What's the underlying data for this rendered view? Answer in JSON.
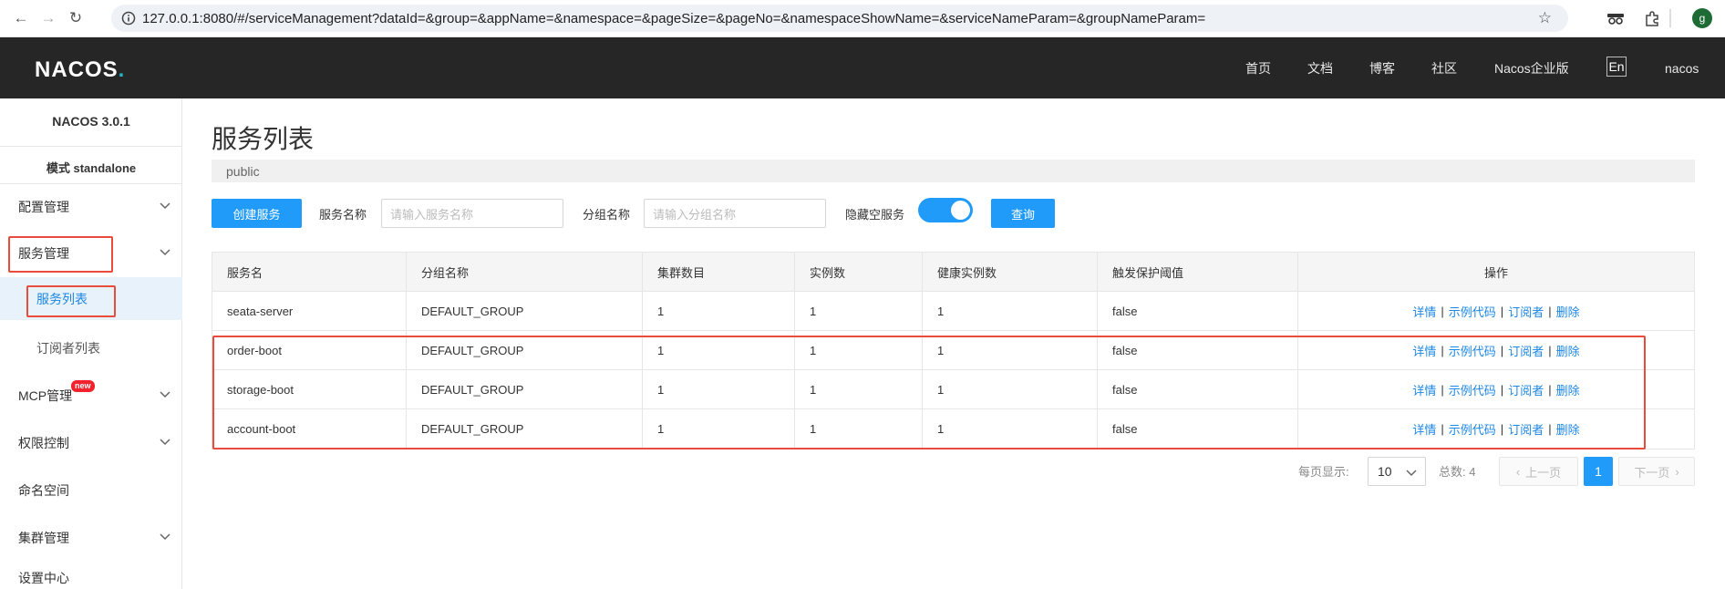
{
  "browser": {
    "url": "127.0.0.1:8080/#/serviceManagement?dataId=&group=&appName=&namespace=&pageSize=&pageNo=&namespaceShowName=&serviceNameParam=&groupNameParam=",
    "profile_initial": "g"
  },
  "header": {
    "logo_text": "NACOS",
    "logo_dot": ".",
    "nav": [
      "首页",
      "文档",
      "博客",
      "社区",
      "Nacos企业版"
    ],
    "lang_button": "En",
    "user": "nacos"
  },
  "sidebar": {
    "version": "NACOS 3.0.1",
    "mode": "模式 standalone",
    "items": {
      "config": "配置管理",
      "service": "服务管理",
      "service_list": "服务列表",
      "subscriber_list": "订阅者列表",
      "mcp": "MCP管理",
      "mcp_badge": "new",
      "auth": "权限控制",
      "namespace": "命名空间",
      "cluster": "集群管理",
      "settings": "设置中心"
    }
  },
  "main": {
    "title": "服务列表",
    "namespace": "public",
    "toolbar": {
      "create_button": "创建服务",
      "service_name_label": "服务名称",
      "service_name_placeholder": "请输入服务名称",
      "group_name_label": "分组名称",
      "group_name_placeholder": "请输入分组名称",
      "hide_empty_label": "隐藏空服务",
      "hide_empty_on": true,
      "query_button": "查询"
    },
    "table": {
      "headers": [
        "服务名",
        "分组名称",
        "集群数目",
        "实例数",
        "健康实例数",
        "触发保护阈值",
        "操作"
      ],
      "rows": [
        [
          "seata-server",
          "DEFAULT_GROUP",
          "1",
          "1",
          "1",
          "false"
        ],
        [
          "order-boot",
          "DEFAULT_GROUP",
          "1",
          "1",
          "1",
          "false"
        ],
        [
          "storage-boot",
          "DEFAULT_GROUP",
          "1",
          "1",
          "1",
          "false"
        ],
        [
          "account-boot",
          "DEFAULT_GROUP",
          "1",
          "1",
          "1",
          "false"
        ]
      ],
      "ops": [
        "详情",
        "示例代码",
        "订阅者",
        "删除"
      ]
    },
    "pagination": {
      "page_size_label": "每页显示:",
      "page_size": "10",
      "total_label": "总数: 4",
      "prev": "上一页",
      "current_page": "1",
      "next": "下一页"
    }
  },
  "colors": {
    "primary": "#209bfa",
    "header_bg": "#262626",
    "highlight_box": "#e74c3c"
  }
}
